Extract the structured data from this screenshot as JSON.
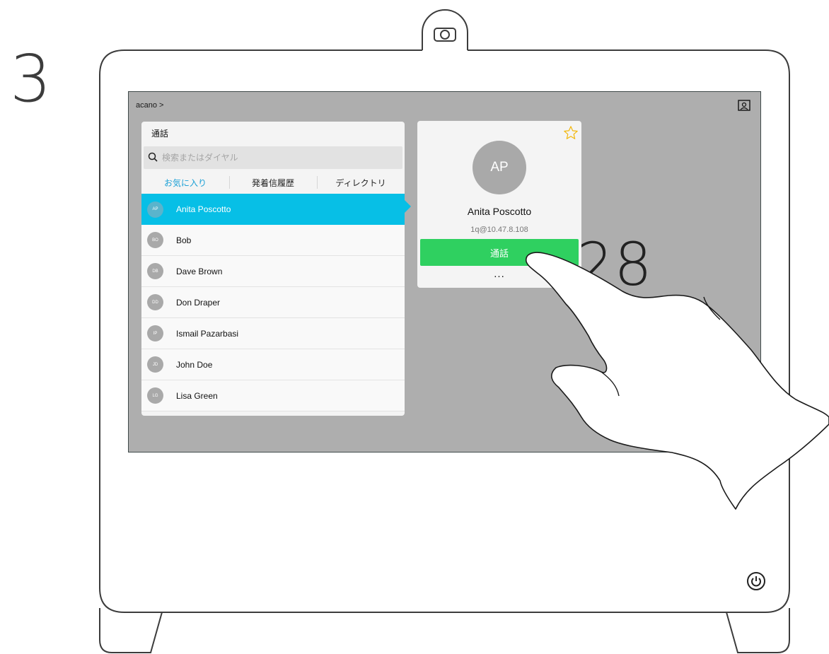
{
  "step": {
    "number": "3"
  },
  "screen": {
    "topbar": {
      "title": "acano >",
      "selfview_icon": "selfview-icon"
    },
    "background_clock": "1:28"
  },
  "call_panel": {
    "title": "通話",
    "search": {
      "placeholder": "検索またはダイヤル",
      "value": "",
      "icon": "search-icon"
    },
    "tabs": [
      {
        "label": "お気に入り",
        "active": true
      },
      {
        "label": "発着信履歴",
        "active": false
      },
      {
        "label": "ディレクトリ",
        "active": false
      }
    ],
    "contacts": [
      {
        "initials": "AP",
        "name": "Anita Poscotto",
        "selected": true
      },
      {
        "initials": "BO",
        "name": "Bob",
        "selected": false
      },
      {
        "initials": "DB",
        "name": "Dave Brown",
        "selected": false
      },
      {
        "initials": "DD",
        "name": "Don Draper",
        "selected": false
      },
      {
        "initials": "IP",
        "name": "Ismail Pazarbasi",
        "selected": false
      },
      {
        "initials": "JD",
        "name": "John Doe",
        "selected": false
      },
      {
        "initials": "LG",
        "name": "Lisa Green",
        "selected": false
      }
    ]
  },
  "detail_card": {
    "initials": "AP",
    "name": "Anita Poscotto",
    "address": "1q@10.47.8.108",
    "call_label": "通話",
    "more_label": "...",
    "favorite_icon": "star-outline-icon"
  },
  "colors": {
    "selection": "#07bfe6",
    "call_green": "#2fd060",
    "active_tab": "#1ba0d6",
    "star": "#f2b70a",
    "screen_bg": "#aeaeae"
  },
  "icons": {
    "camera": "camera-icon",
    "power": "power-icon",
    "hand": "hand-pointer-icon"
  }
}
